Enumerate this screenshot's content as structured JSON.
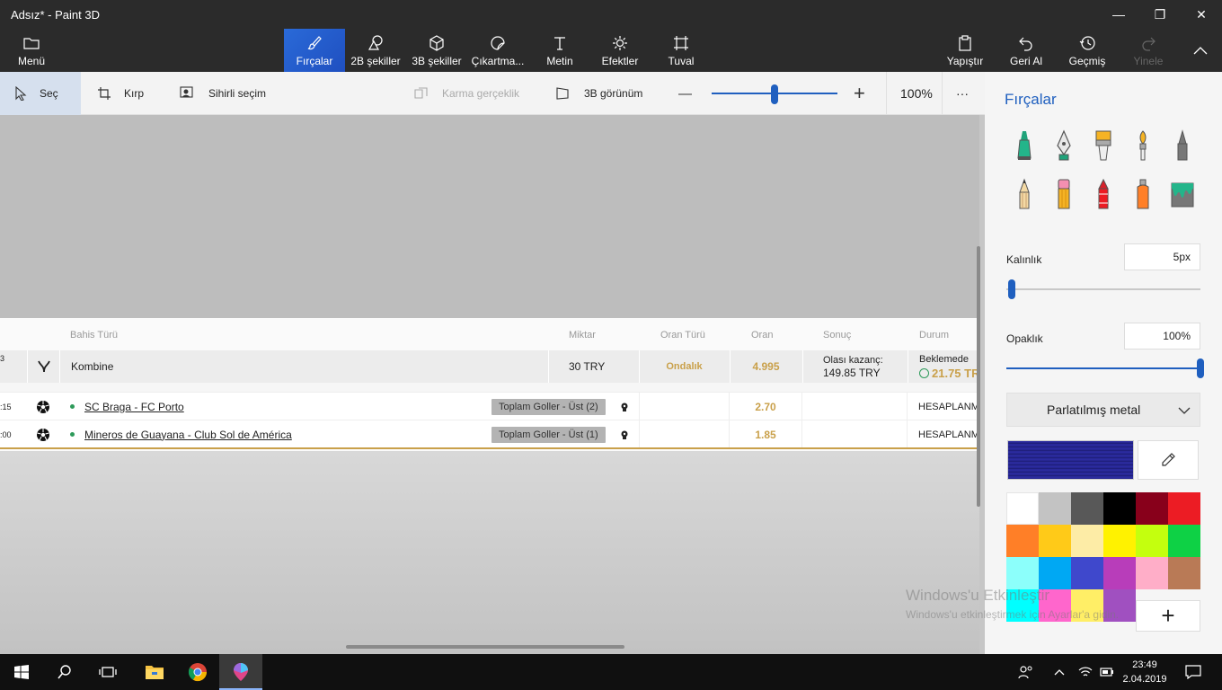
{
  "app": {
    "title": "Adsız* - Paint 3D"
  },
  "window_controls": {
    "minimize": "—",
    "maximize": "❐",
    "close": "✕"
  },
  "toolbar": {
    "menu": "Menü",
    "tools": [
      {
        "label": "Fırçalar",
        "icon": "brush-icon",
        "active": true
      },
      {
        "label": "2B şekiller",
        "icon": "2d-shapes-icon"
      },
      {
        "label": "3B şekiller",
        "icon": "3d-shapes-icon"
      },
      {
        "label": "Çıkartma...",
        "icon": "sticker-icon"
      },
      {
        "label": "Metin",
        "icon": "text-icon"
      },
      {
        "label": "Efektler",
        "icon": "effects-icon"
      },
      {
        "label": "Tuval",
        "icon": "canvas-icon"
      }
    ],
    "right": [
      {
        "label": "Yapıştır",
        "icon": "paste-icon"
      },
      {
        "label": "Geri Al",
        "icon": "undo-icon"
      },
      {
        "label": "Geçmiş",
        "icon": "history-icon"
      },
      {
        "label": "Yinele",
        "icon": "redo-icon",
        "disabled": true
      }
    ]
  },
  "subbar": {
    "select": "Seç",
    "crop": "Kırp",
    "magic_select": "Sihirli seçim",
    "mixed_reality": "Karma gerçeklik",
    "view_3d": "3B görünüm",
    "zoom_minus": "—",
    "zoom_plus": "+",
    "zoom_level": 0.5,
    "zoom": "100%",
    "more": "···"
  },
  "bet": {
    "headers": {
      "type": "Bahis Türü",
      "amount": "Miktar",
      "odds_type": "Oran Türü",
      "odds": "Oran",
      "result": "Sonuç",
      "status": "Durum"
    },
    "summary": {
      "left_fragment": "3",
      "type": "Kombine",
      "amount": "30  TRY",
      "odds_type": "Ondalık",
      "odds": "4.995",
      "result_line1": "Olası kazanç:",
      "result_line2": "149.85 TRY",
      "status_line1": "Beklemede",
      "status_line2": "21.75 TR"
    },
    "rows": [
      {
        "time": ":15",
        "match": "SC Braga - FC Porto",
        "market": "Toplam Goller - Üst (2)",
        "odds": "2.70",
        "status": "HESAPLANM/"
      },
      {
        "time": ":00",
        "match": "Mineros de Guayana - Club Sol de América",
        "market": "Toplam Goller - Üst (1)",
        "odds": "1.85",
        "status": "HESAPLANM/"
      }
    ]
  },
  "panel": {
    "title": "Fırçalar",
    "thickness_label": "Kalınlık",
    "thickness_value": "5px",
    "thickness_level": 0.03,
    "opacity_label": "Opaklık",
    "opacity_value": "100%",
    "opacity_level": 1.0,
    "material": "Parlatılmış metal",
    "current_color": "#2a2a9a",
    "palette": [
      "#ffffff",
      "#c3c3c3",
      "#585858",
      "#000000",
      "#88001b",
      "#ec1c24",
      "#ff7f27",
      "#ffca18",
      "#fdeca6",
      "#fff200",
      "#c4ff0e",
      "#0ed145",
      "#8cfffb",
      "#00a8f3",
      "#3f48cc",
      "#b83dba",
      "#ffaec8",
      "#b97a56",
      "#00ffff",
      "#ff66cc",
      "#ffee66",
      "#a050c0"
    ],
    "add_color": "+"
  },
  "watermark": {
    "line1": "Windows'u Etkinleştir",
    "line2": "Windows'u etkinleştirmek için Ayarlar'a gidin."
  },
  "taskbar": {
    "time": "23:49",
    "date": "2.04.2019"
  }
}
